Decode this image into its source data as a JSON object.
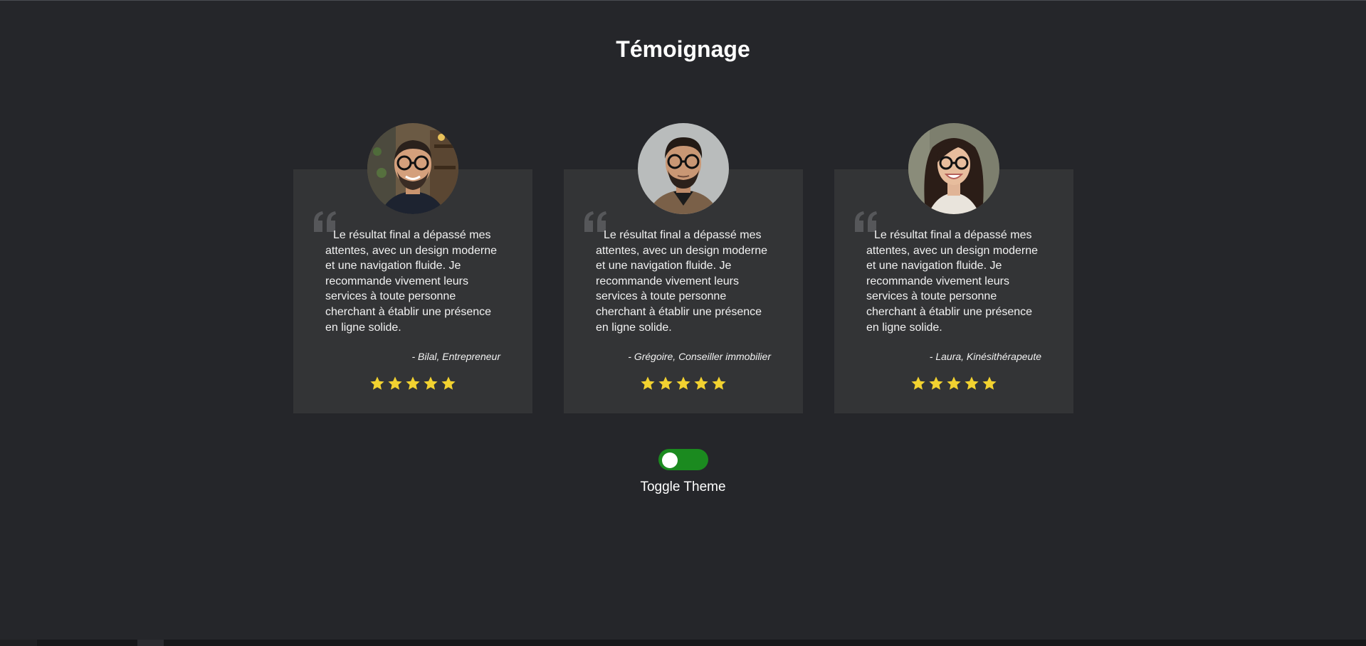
{
  "page": {
    "title": "Témoignage",
    "background_color": "#25262a",
    "card_color": "#333436"
  },
  "testimonials": [
    {
      "quote": "Le résultat final a dépassé mes attentes, avec un design moderne et une navigation fluide. Je recommande vivement leurs services à toute personne cherchant à établir une présence en ligne solide.",
      "author": "- Bilal, Entrepreneur",
      "rating": 5,
      "avatar": "man-with-glasses-photo"
    },
    {
      "quote": "Le résultat final a dépassé mes attentes, avec un design moderne et une navigation fluide. Je recommande vivement leurs services à toute personne cherchant à établir une présence en ligne solide.",
      "author": "- Grégoire, Conseiller immobilier",
      "rating": 5,
      "avatar": "man-with-glasses-photo"
    },
    {
      "quote": "Le résultat final a dépassé mes attentes, avec un design moderne et une navigation fluide. Je recommande vivement leurs services à toute personne cherchant à établir une présence en ligne solide.",
      "author": "- Laura, Kinésithérapeute",
      "rating": 5,
      "avatar": "woman-with-glasses-photo"
    }
  ],
  "star_color": "#f2d230",
  "quote_icon": "quote-open-icon",
  "theme_toggle": {
    "label": "Toggle Theme",
    "state": "on",
    "track_color": "#1b8a1f"
  }
}
